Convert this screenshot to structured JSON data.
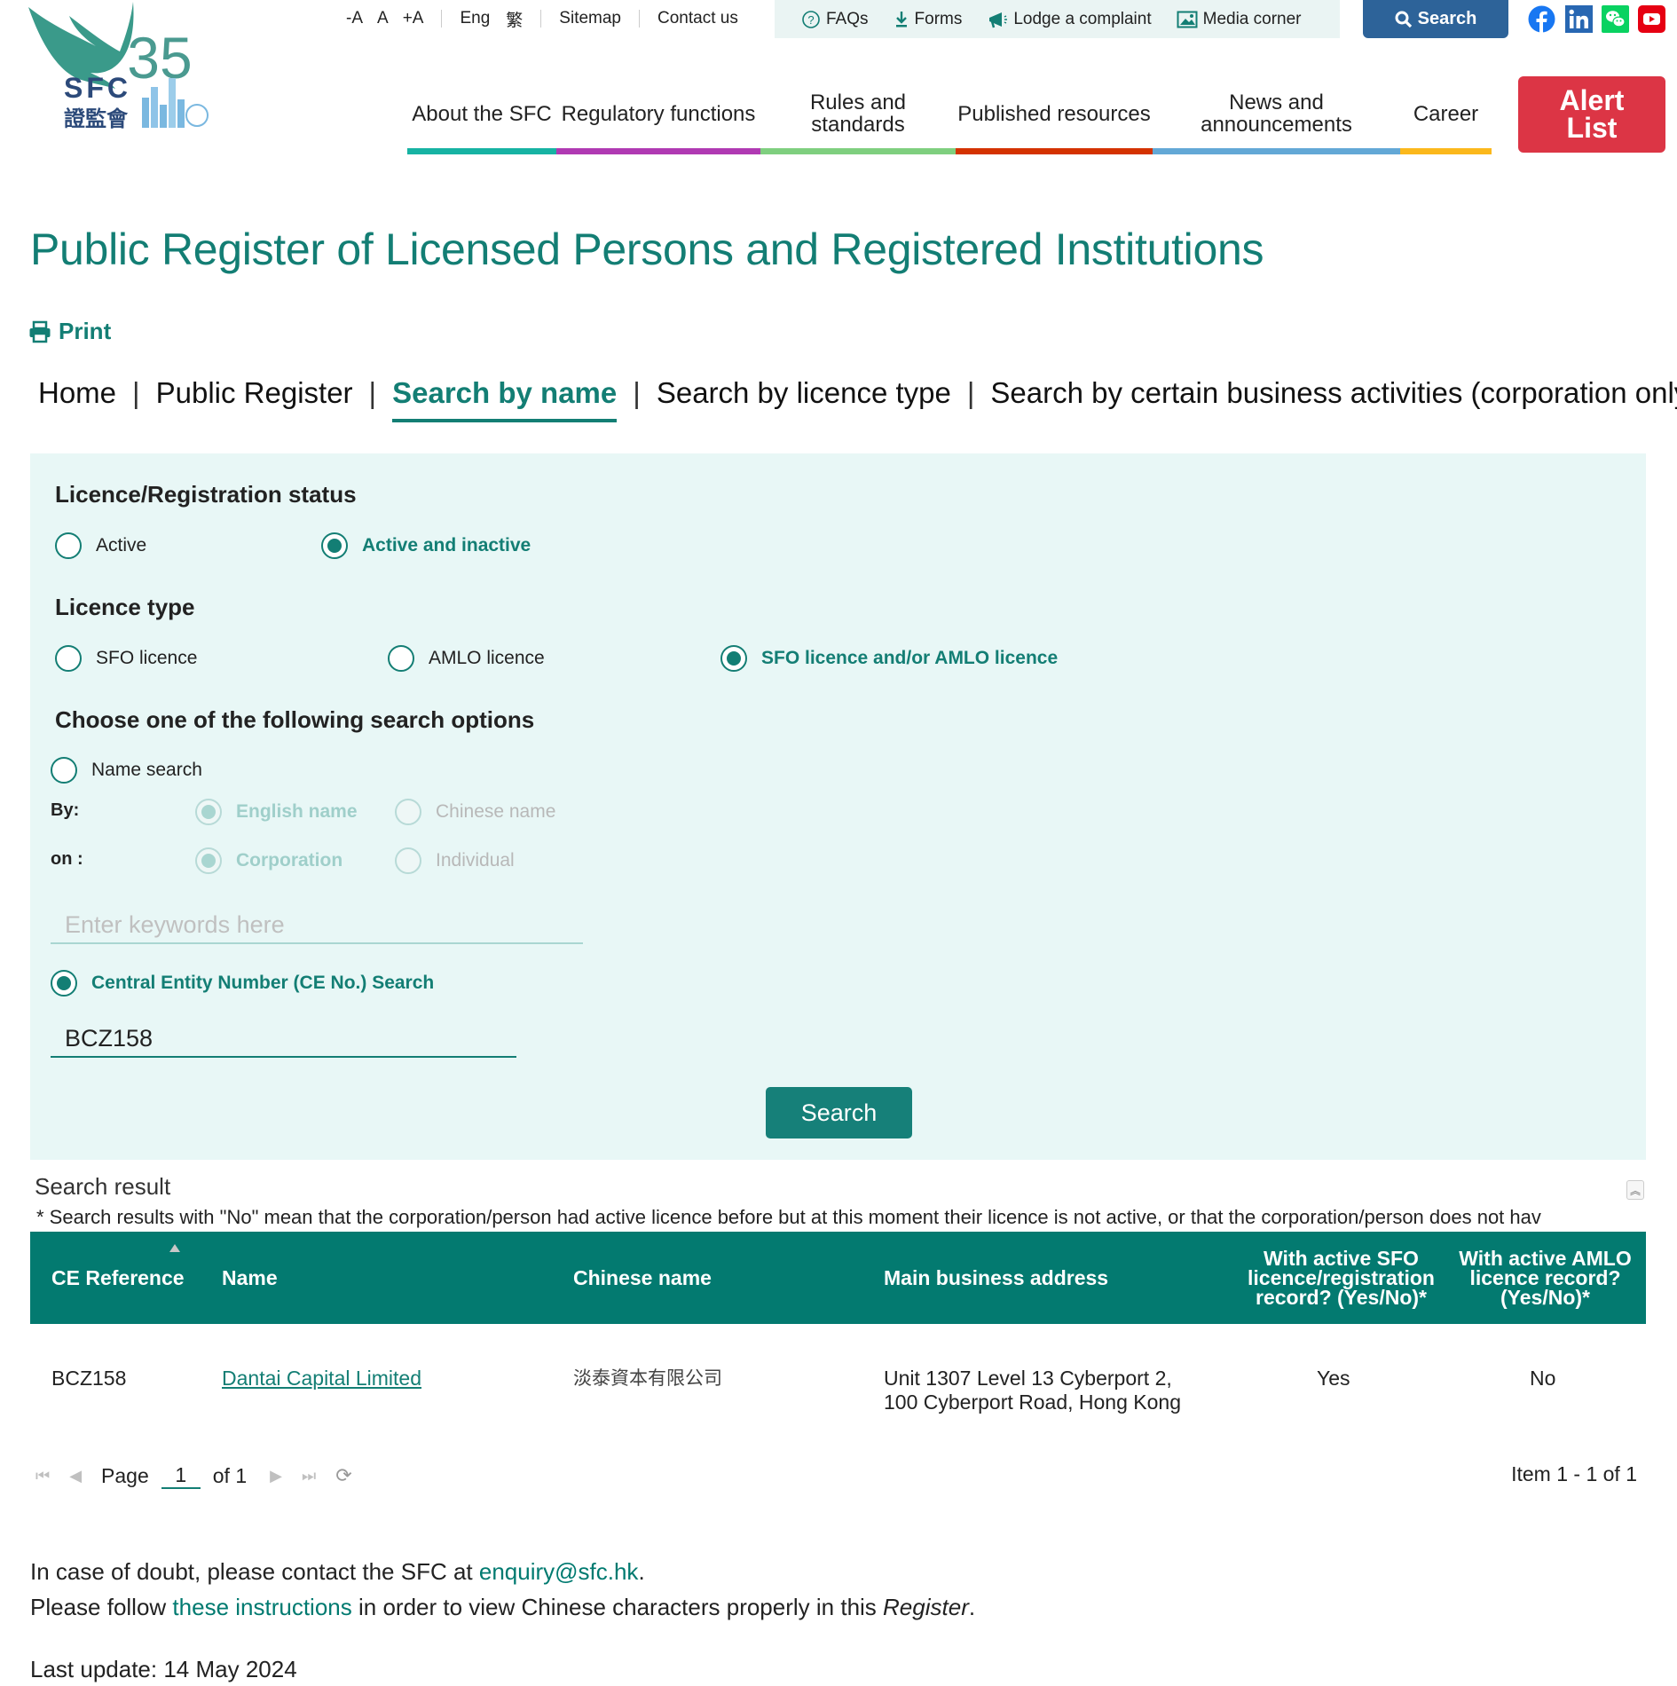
{
  "header": {
    "logo_text": "SFC",
    "logo_chinese": "證監會",
    "logo_anniversary": "35",
    "font_size_controls": [
      "-A",
      "A",
      "+A"
    ],
    "languages": [
      "Eng",
      "繁"
    ],
    "sitemap": "Sitemap",
    "contact_us": "Contact us",
    "quick_links": [
      {
        "label": "FAQs",
        "icon": "question-circle-icon"
      },
      {
        "label": "Forms",
        "icon": "download-icon"
      },
      {
        "label": "Lodge a complaint",
        "icon": "megaphone-icon"
      },
      {
        "label": "Media corner",
        "icon": "image-icon"
      }
    ],
    "search_label": "Search",
    "social": [
      "facebook",
      "linkedin",
      "wechat",
      "youtube"
    ]
  },
  "nav": {
    "items": [
      {
        "label": "About the SFC",
        "color": "#17b3a3"
      },
      {
        "label": "Regulatory functions",
        "color": "#b03ab3"
      },
      {
        "label": "Rules and standards",
        "color": "#7fcf7f"
      },
      {
        "label": "Published resources",
        "color": "#d43200"
      },
      {
        "label": "News and announcements",
        "color": "#63a8d6"
      },
      {
        "label": "Career",
        "color": "#fbb81c"
      }
    ],
    "alert_list": "Alert List"
  },
  "page": {
    "title": "Public Register of Licensed Persons and Registered Institutions",
    "print": "Print",
    "breadcrumb": [
      "Home",
      "Public Register",
      "Search by name",
      "Search by licence type",
      "Search by certain business activities (corporation only)"
    ]
  },
  "form": {
    "status_heading": "Licence/Registration status",
    "status_options": [
      {
        "label": "Active",
        "selected": false
      },
      {
        "label": "Active and inactive",
        "selected": true
      }
    ],
    "licence_heading": "Licence type",
    "licence_options": [
      {
        "label": "SFO licence",
        "selected": false
      },
      {
        "label": "AMLO licence",
        "selected": false
      },
      {
        "label": "SFO licence and/or AMLO licence",
        "selected": true
      }
    ],
    "options_heading": "Choose one of the following search options",
    "name_search": {
      "label": "Name search",
      "selected": false
    },
    "by_label": "By:",
    "by_options": [
      {
        "label": "English name",
        "selected": true
      },
      {
        "label": "Chinese name",
        "selected": false
      }
    ],
    "on_label": "on :",
    "on_options": [
      {
        "label": "Corporation",
        "selected": true
      },
      {
        "label": "Individual",
        "selected": false
      }
    ],
    "keyword_placeholder": "Enter keywords here",
    "ce_search": {
      "label": "Central Entity Number (CE No.) Search",
      "selected": true
    },
    "ce_value": "BCZ158",
    "search_button": "Search"
  },
  "results": {
    "label": "Search result",
    "note": "* Search results with \"No\" mean that the corporation/person had active licence before but at this moment their licence is not active, or that the corporation/person does not hav",
    "columns": [
      "CE Reference",
      "Name",
      "Chinese name",
      "Main business address",
      "With active SFO licence/registration record? (Yes/No)*",
      "With active AMLO licence record? (Yes/No)*"
    ],
    "rows": [
      {
        "ce_ref": "BCZ158",
        "name": "Dantai Capital Limited",
        "chinese_name": "淡泰資本有限公司",
        "address_line1": "Unit 1307 Level 13 Cyberport 2,",
        "address_line2": "100 Cyberport Road, Hong Kong",
        "sfo": "Yes",
        "amlo": "No"
      }
    ],
    "pager": {
      "page_label": "Page",
      "current": "1",
      "of_label": "of 1"
    },
    "item_count": "Item 1 - 1 of 1"
  },
  "footer": {
    "doubt_prefix": "In case of doubt, please contact the SFC at ",
    "email": "enquiry@sfc.hk",
    "doubt_suffix": ".",
    "follow_prefix": "Please follow ",
    "instructions_link": "these instructions ",
    "follow_middle": "in order to view Chinese characters properly in this ",
    "register_word": "Register",
    "follow_suffix": ".",
    "last_update": "Last update: 14 May 2024"
  }
}
